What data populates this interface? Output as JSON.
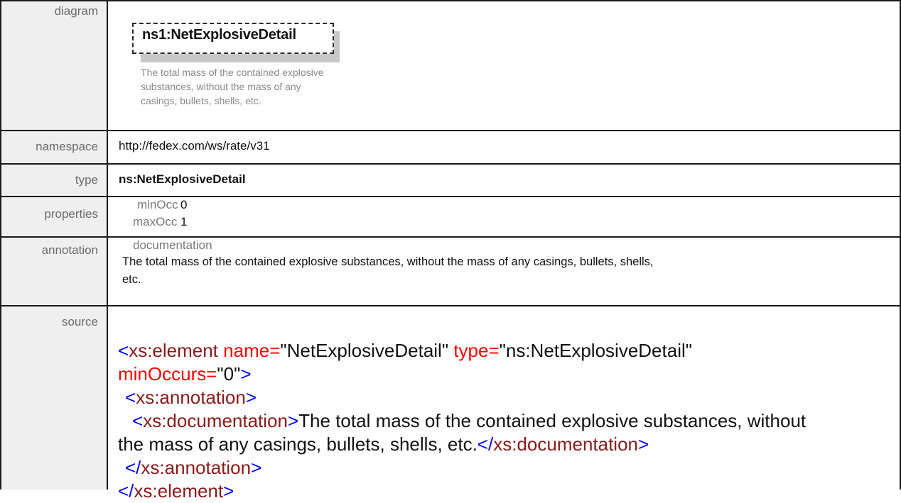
{
  "rows": {
    "diagram": {
      "label": "diagram",
      "element_prefix": "ns1:",
      "element_name": "NetExplosiveDetail",
      "description": "The total mass of the contained explosive substances, without the mass of any casings, bullets, shells, etc."
    },
    "namespace": {
      "label": "namespace",
      "value": "http://fedex.com/ws/rate/v31"
    },
    "type": {
      "label": "type",
      "value": "ns:NetExplosiveDetail"
    },
    "properties": {
      "label": "properties",
      "min_label": "minOcc",
      "min_value": "0",
      "max_label": "maxOcc",
      "max_value": "1"
    },
    "annotation": {
      "label": "annotation",
      "doc_label": "documentation",
      "line1": "The total mass of the contained explosive substances, without the mass of any casings, bullets, shells,",
      "line2": "etc."
    },
    "source": {
      "label": "source",
      "el_open": "xs:element",
      "attr_name": "name=",
      "attr_name_val": "\"NetExplosiveDetail\"",
      "attr_type": "type=",
      "attr_type_val": "\"ns:NetExplosiveDetail\"",
      "attr_min": "minOccurs=",
      "attr_min_val": "\"0\"",
      "annotation_tag": "xs:annotation",
      "documentation_tag": "xs:documentation",
      "doc_text_1": "The total mass of the contained explosive substances, without",
      "doc_text_2": "the mass of any casings, bullets, shells, etc.",
      "lt": "<",
      "gt": ">",
      "lt_slash": "</"
    }
  }
}
